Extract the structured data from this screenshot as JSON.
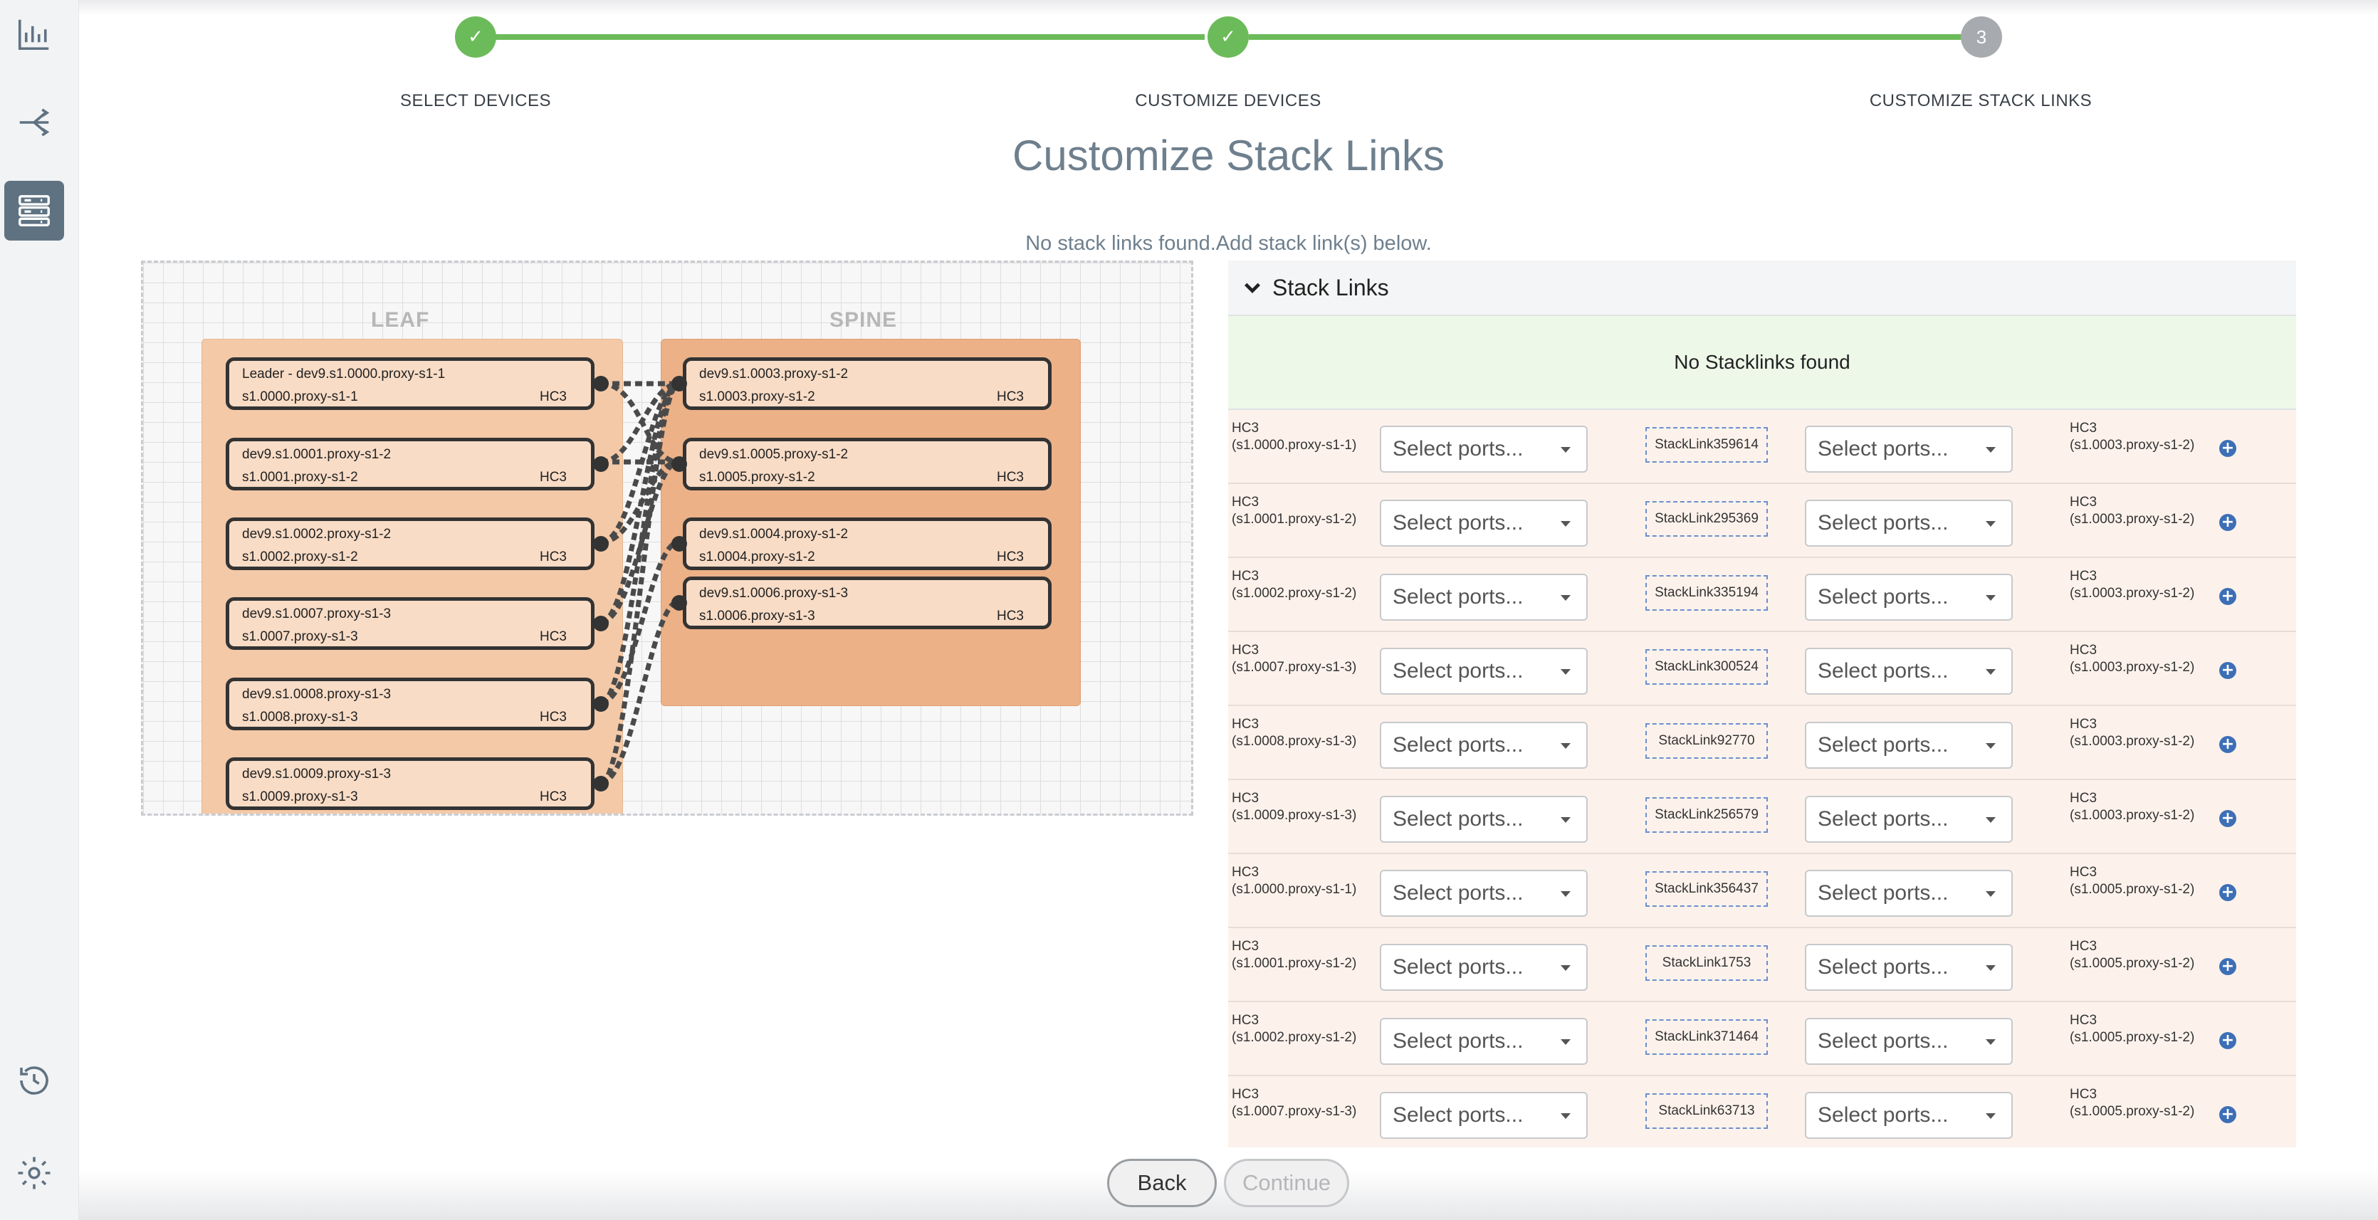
{
  "stepper": {
    "steps": [
      {
        "label": "SELECT DEVICES",
        "marker": "✓"
      },
      {
        "label": "CUSTOMIZE DEVICES",
        "marker": "✓"
      },
      {
        "label": "CUSTOMIZE STACK LINKS",
        "marker": "3"
      }
    ]
  },
  "page": {
    "title": "Customize Stack Links",
    "notice": "No stack links found.Add stack link(s) below."
  },
  "sidebar": {
    "icons": [
      "bar-chart-icon",
      "network-icon",
      "server-stack-icon",
      "history-icon",
      "gear-icon"
    ]
  },
  "diagram": {
    "leaf_label": "LEAF",
    "spine_label": "SPINE",
    "leaf_nodes": [
      {
        "name": "Leader - dev9.s1.0000.proxy-s1-1",
        "id": "s1.0000.proxy-s1-1",
        "model": "HC3"
      },
      {
        "name": "dev9.s1.0001.proxy-s1-2",
        "id": "s1.0001.proxy-s1-2",
        "model": "HC3"
      },
      {
        "name": "dev9.s1.0002.proxy-s1-2",
        "id": "s1.0002.proxy-s1-2",
        "model": "HC3"
      },
      {
        "name": "dev9.s1.0007.proxy-s1-3",
        "id": "s1.0007.proxy-s1-3",
        "model": "HC3"
      },
      {
        "name": "dev9.s1.0008.proxy-s1-3",
        "id": "s1.0008.proxy-s1-3",
        "model": "HC3"
      },
      {
        "name": "dev9.s1.0009.proxy-s1-3",
        "id": "s1.0009.proxy-s1-3",
        "model": "HC3"
      }
    ],
    "spine_nodes": [
      {
        "name": "dev9.s1.0003.proxy-s1-2",
        "id": "s1.0003.proxy-s1-2",
        "model": "HC3"
      },
      {
        "name": "dev9.s1.0005.proxy-s1-2",
        "id": "s1.0005.proxy-s1-2",
        "model": "HC3"
      },
      {
        "name": "dev9.s1.0004.proxy-s1-2",
        "id": "s1.0004.proxy-s1-2",
        "model": "HC3"
      },
      {
        "name": "dev9.s1.0006.proxy-s1-3",
        "id": "s1.0006.proxy-s1-3",
        "model": "HC3"
      }
    ]
  },
  "stack_links": {
    "header": "Stack Links",
    "empty_message": "No Stacklinks found",
    "select_placeholder": "Select ports...",
    "rows": [
      {
        "src_model": "HC3",
        "src_id": "(s1.0000.proxy-s1-1)",
        "link": "StackLink359614",
        "dst_model": "HC3",
        "dst_id": "(s1.0003.proxy-s1-2)"
      },
      {
        "src_model": "HC3",
        "src_id": "(s1.0001.proxy-s1-2)",
        "link": "StackLink295369",
        "dst_model": "HC3",
        "dst_id": "(s1.0003.proxy-s1-2)"
      },
      {
        "src_model": "HC3",
        "src_id": "(s1.0002.proxy-s1-2)",
        "link": "StackLink335194",
        "dst_model": "HC3",
        "dst_id": "(s1.0003.proxy-s1-2)"
      },
      {
        "src_model": "HC3",
        "src_id": "(s1.0007.proxy-s1-3)",
        "link": "StackLink300524",
        "dst_model": "HC3",
        "dst_id": "(s1.0003.proxy-s1-2)"
      },
      {
        "src_model": "HC3",
        "src_id": "(s1.0008.proxy-s1-3)",
        "link": "StackLink92770",
        "dst_model": "HC3",
        "dst_id": "(s1.0003.proxy-s1-2)"
      },
      {
        "src_model": "HC3",
        "src_id": "(s1.0009.proxy-s1-3)",
        "link": "StackLink256579",
        "dst_model": "HC3",
        "dst_id": "(s1.0003.proxy-s1-2)"
      },
      {
        "src_model": "HC3",
        "src_id": "(s1.0000.proxy-s1-1)",
        "link": "StackLink356437",
        "dst_model": "HC3",
        "dst_id": "(s1.0005.proxy-s1-2)"
      },
      {
        "src_model": "HC3",
        "src_id": "(s1.0001.proxy-s1-2)",
        "link": "StackLink1753",
        "dst_model": "HC3",
        "dst_id": "(s1.0005.proxy-s1-2)"
      },
      {
        "src_model": "HC3",
        "src_id": "(s1.0002.proxy-s1-2)",
        "link": "StackLink371464",
        "dst_model": "HC3",
        "dst_id": "(s1.0005.proxy-s1-2)"
      },
      {
        "src_model": "HC3",
        "src_id": "(s1.0007.proxy-s1-3)",
        "link": "StackLink63713",
        "dst_model": "HC3",
        "dst_id": "(s1.0005.proxy-s1-2)"
      }
    ]
  },
  "footer": {
    "back_label": "Back",
    "continue_label": "Continue"
  }
}
